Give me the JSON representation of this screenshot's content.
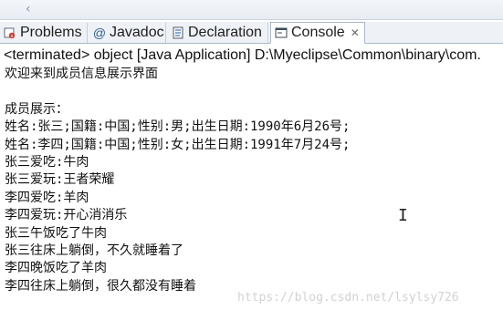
{
  "top_bar": {
    "back_icon": "chevron-left"
  },
  "tabs": [
    {
      "label": "Problems",
      "icon": "problems-icon",
      "active": false
    },
    {
      "label": "Javadoc",
      "icon": "at-sign-icon",
      "active": false
    },
    {
      "label": "Declaration",
      "icon": "declaration-icon",
      "active": false
    },
    {
      "label": "Console",
      "icon": "console-icon",
      "active": true,
      "close_icon": "close-icon"
    }
  ],
  "status_line": "<terminated> object [Java Application] D:\\Myeclipse\\Common\\binary\\com.",
  "console_lines": [
    "欢迎来到成员信息展示界面",
    "",
    "成员展示：",
    "姓名:张三;国籍:中国;性别:男;出生日期:1990年6月26号;",
    "姓名:李四;国籍:中国;性别:女;出生日期:1991年7月24号;",
    "张三爱吃:牛肉",
    "张三爱玩:王者荣耀",
    "李四爱吃:羊肉",
    "李四爱玩:开心消消乐",
    "张三午饭吃了牛肉",
    "张三往床上躺倒，不久就睡着了",
    "李四晚饭吃了羊肉",
    "李四往床上躺倒，很久都没有睡着"
  ],
  "watermark": "https://blog.csdn.net/lsylsy726",
  "colors": {
    "tab_active_bg": "#ffffff",
    "tab_bar_bg": "#eef2f7",
    "border": "#a9b7c8"
  }
}
